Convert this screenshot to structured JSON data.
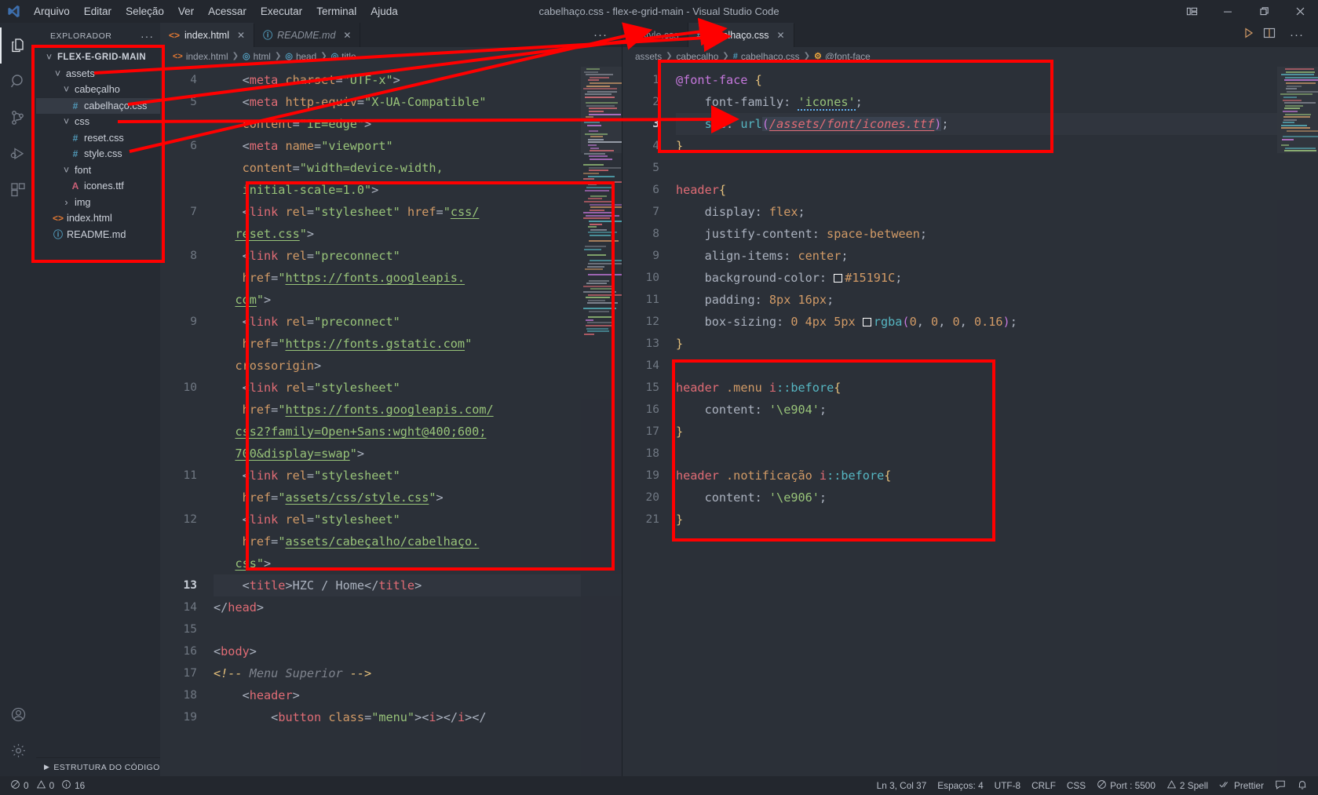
{
  "window": {
    "title": "cabelhaço.css - flex-e-grid-main - Visual Studio Code",
    "menu": [
      "Arquivo",
      "Editar",
      "Seleção",
      "Ver",
      "Acessar",
      "Executar",
      "Terminal",
      "Ajuda"
    ],
    "controls": {
      "layout": "layout-icon",
      "minimize": "—",
      "maximize": "❐",
      "close": "✕"
    }
  },
  "activitybar": {
    "items": [
      {
        "name": "explorer",
        "icon": "files-icon",
        "active": true
      },
      {
        "name": "search",
        "icon": "search-icon",
        "active": false
      },
      {
        "name": "source-control",
        "icon": "source-control-icon",
        "active": false
      },
      {
        "name": "run-and-debug",
        "icon": "run-debug-icon",
        "active": false
      },
      {
        "name": "extensions",
        "icon": "extensions-icon",
        "active": false
      }
    ],
    "bottom": [
      {
        "name": "accounts",
        "icon": "account-icon"
      },
      {
        "name": "settings",
        "icon": "gear-icon"
      }
    ]
  },
  "sidebar": {
    "header": "EXPLORADOR",
    "more": "···",
    "root": "FLEX-E-GRID-MAIN",
    "tree": [
      {
        "label": "FLEX-E-GRID-MAIN",
        "depth": 0,
        "kind": "root",
        "expanded": true
      },
      {
        "label": "assets",
        "depth": 1,
        "kind": "folder",
        "expanded": true
      },
      {
        "label": "cabeçalho",
        "depth": 2,
        "kind": "folder",
        "expanded": true
      },
      {
        "label": "cabelhaço.css",
        "depth": 3,
        "kind": "css",
        "selected": true
      },
      {
        "label": "css",
        "depth": 2,
        "kind": "folder",
        "expanded": true
      },
      {
        "label": "reset.css",
        "depth": 3,
        "kind": "css"
      },
      {
        "label": "style.css",
        "depth": 3,
        "kind": "css"
      },
      {
        "label": "font",
        "depth": 2,
        "kind": "folder",
        "expanded": true
      },
      {
        "label": "icones.ttf",
        "depth": 3,
        "kind": "ttf"
      },
      {
        "label": "img",
        "depth": 2,
        "kind": "folder",
        "expanded": false
      },
      {
        "label": "index.html",
        "depth": 1,
        "kind": "html"
      },
      {
        "label": "README.md",
        "depth": 1,
        "kind": "md"
      }
    ],
    "footer": "ESTRUTURA DO CÓDIGO"
  },
  "left_editor": {
    "tabs": [
      {
        "label": "index.html",
        "kind": "html",
        "active": true,
        "italic": false,
        "close": "✕"
      },
      {
        "label": "README.md",
        "kind": "md",
        "active": false,
        "italic": true,
        "close": "✕"
      }
    ],
    "more": "···",
    "breadcrumb": [
      {
        "label": "index.html",
        "icon": "html-icon"
      },
      {
        "label": "html",
        "icon": "tag-icon"
      },
      {
        "label": "head",
        "icon": "tag-icon"
      },
      {
        "label": "title",
        "icon": "tag-icon"
      }
    ],
    "first_line_number": 4,
    "lines": [
      {
        "n": "4",
        "html": "    <span class='t-punc'>&lt;</span><span class='t-tag'>meta</span> <span class='t-attr'>charset</span><span class='t-punc'>=</span><span class='t-str'>\"UTF-x\"</span><span class='t-punc'>&gt;</span>"
      },
      {
        "n": "5",
        "html": "    <span class='t-punc'>&lt;</span><span class='t-tag'>meta</span> <span class='t-attr'>http-equiv</span><span class='t-punc'>=</span><span class='t-str'>\"X-UA-Compatible\"</span>"
      },
      {
        "n": "",
        "html": "    <span class='t-attr'>content</span><span class='t-punc'>=</span><span class='t-str'>\"IE=edge\"</span><span class='t-punc'>&gt;</span>"
      },
      {
        "n": "6",
        "html": "    <span class='t-punc'>&lt;</span><span class='t-tag'>meta</span> <span class='t-attr'>name</span><span class='t-punc'>=</span><span class='t-str'>\"viewport\"</span>"
      },
      {
        "n": "",
        "html": "    <span class='t-attr'>content</span><span class='t-punc'>=</span><span class='t-str'>\"width=device-width,</span>"
      },
      {
        "n": "",
        "html": "    <span class='t-str'>initial-scale=1.0\"</span><span class='t-punc'>&gt;</span>"
      },
      {
        "n": "7",
        "html": "    <span class='t-punc'>&lt;</span><span class='t-tag'>link</span> <span class='t-attr'>rel</span><span class='t-punc'>=</span><span class='t-str'>\"stylesheet\"</span> <span class='t-attr'>href</span><span class='t-punc'>=</span><span class='t-str'>\"</span><span class='t-strlnk'>css/</span>"
      },
      {
        "n": "",
        "html": "   <span class='t-strlnk'>reset.css</span><span class='t-str'>\"</span><span class='t-punc'>&gt;</span>"
      },
      {
        "n": "8",
        "html": "    <span class='t-punc'>&lt;</span><span class='t-tag'>link</span> <span class='t-attr'>rel</span><span class='t-punc'>=</span><span class='t-str'>\"preconnect\"</span>"
      },
      {
        "n": "",
        "html": "    <span class='t-attr'>href</span><span class='t-punc'>=</span><span class='t-str'>\"</span><span class='t-strlnk'>https://fonts.googleapis.</span>"
      },
      {
        "n": "",
        "html": "   <span class='t-strlnk'>com</span><span class='t-str'>\"</span><span class='t-punc'>&gt;</span>"
      },
      {
        "n": "9",
        "html": "    <span class='t-punc'>&lt;</span><span class='t-tag'>link</span> <span class='t-attr'>rel</span><span class='t-punc'>=</span><span class='t-str'>\"preconnect\"</span>"
      },
      {
        "n": "",
        "html": "    <span class='t-attr'>href</span><span class='t-punc'>=</span><span class='t-str'>\"</span><span class='t-strlnk'>https://fonts.gstatic.com</span><span class='t-str'>\"</span>"
      },
      {
        "n": "",
        "html": "   <span class='t-attr'>crossorigin</span><span class='t-punc'>&gt;</span>"
      },
      {
        "n": "10",
        "html": "    <span class='t-punc'>&lt;</span><span class='t-tag'>link</span> <span class='t-attr'>rel</span><span class='t-punc'>=</span><span class='t-str'>\"stylesheet\"</span>"
      },
      {
        "n": "",
        "html": "    <span class='t-attr'>href</span><span class='t-punc'>=</span><span class='t-str'>\"</span><span class='t-strlnk'>https://fonts.googleapis.com/</span>"
      },
      {
        "n": "",
        "html": "   <span class='t-strlnk'>css2?family=Open+Sans:wght@400;600;</span>"
      },
      {
        "n": "",
        "html": "   <span class='t-strlnk'>700&amp;display=swap</span><span class='t-str'>\"</span><span class='t-punc'>&gt;</span>"
      },
      {
        "n": "11",
        "html": "    <span class='t-punc'>&lt;</span><span class='t-tag'>link</span> <span class='t-attr'>rel</span><span class='t-punc'>=</span><span class='t-str'>\"stylesheet\"</span>"
      },
      {
        "n": "",
        "html": "    <span class='t-attr'>href</span><span class='t-punc'>=</span><span class='t-str'>\"</span><span class='t-strlnk'>assets/css/style.css</span><span class='t-str'>\"</span><span class='t-punc'>&gt;</span>"
      },
      {
        "n": "12",
        "html": "    <span class='t-punc'>&lt;</span><span class='t-tag'>link</span> <span class='t-attr'>rel</span><span class='t-punc'>=</span><span class='t-str'>\"stylesheet\"</span>"
      },
      {
        "n": "",
        "html": "    <span class='t-attr'>href</span><span class='t-punc'>=</span><span class='t-str'>\"</span><span class='t-strlnk'>assets/cabeçalho/cabelhaço.</span>"
      },
      {
        "n": "",
        "html": "   <span class='t-strlnk'>css</span><span class='t-str'>\"</span><span class='t-punc'>&gt;</span>"
      },
      {
        "n": "13",
        "html": "    <span class='t-punc'>&lt;</span><span class='t-tag'>title</span><span class='t-punc'>&gt;</span>HZC / Home<span class='t-punc'>&lt;/</span><span class='t-tag'>title</span><span class='t-punc'>&gt;</span>",
        "cur": true,
        "hl": true
      },
      {
        "n": "14",
        "html": "<span class='t-punc'>&lt;/</span><span class='t-tag'>head</span><span class='t-punc'>&gt;</span>"
      },
      {
        "n": "15",
        "html": ""
      },
      {
        "n": "16",
        "html": "<span class='t-punc'>&lt;</span><span class='t-tag'>body</span><span class='t-punc'>&gt;</span>"
      },
      {
        "n": "17",
        "html": "<span class='t-cmtm'>&lt;!--</span> <span class='t-cmt'>Menu Superior</span> <span class='t-cmtm'>--&gt;</span>"
      },
      {
        "n": "18",
        "html": "    <span class='t-punc'>&lt;</span><span class='t-tag'>header</span><span class='t-punc'>&gt;</span>"
      },
      {
        "n": "19",
        "html": "        <span class='t-punc'>&lt;</span><span class='t-tag'>button</span> <span class='t-attr'>class</span><span class='t-punc'>=</span><span class='t-str'>\"menu\"</span><span class='t-punc'>&gt;&lt;</span><span class='t-tag'>i</span><span class='t-punc'>&gt;&lt;/</span><span class='t-tag'>i</span><span class='t-punc'>&gt;&lt;/</span>"
      }
    ]
  },
  "right_editor": {
    "tabs": [
      {
        "label": "style.css",
        "kind": "css",
        "active": false,
        "close": ""
      },
      {
        "label": "cabelhaço.css",
        "kind": "css",
        "active": true,
        "close": "✕"
      }
    ],
    "actions": {
      "run": "run-icon",
      "split": "split-editor-icon",
      "more": "···"
    },
    "breadcrumb": [
      {
        "label": "assets",
        "icon": ""
      },
      {
        "label": "cabeçalho",
        "icon": ""
      },
      {
        "label": "cabelhaço.css",
        "icon": "css-icon"
      },
      {
        "label": "@font-face",
        "icon": "at-rule-icon"
      }
    ],
    "lines": [
      {
        "n": "1",
        "html": "<span class='t-at'>@font-face</span> <span class='t-brace'>{</span>"
      },
      {
        "n": "2",
        "html": "    <span class='t-prop'>font-family</span><span class='t-punc'>:</span> <span class='t-squig t-qstr'>'icones'</span><span class='t-punc'>;</span>"
      },
      {
        "n": "3",
        "html": "    <span class='t-fn'>src</span><span class='t-punc'>:</span> <span class='t-fn'>url</span><span class='t-urlsel'><span class='t-paren'>(</span><span class='t-url'>/assets/font/icones.ttf</span><span class='t-paren'>)</span></span><span class='t-punc'>;</span>",
        "cur": true,
        "hl": true
      },
      {
        "n": "4",
        "html": "<span class='t-brace'>}</span>"
      },
      {
        "n": "5",
        "html": ""
      },
      {
        "n": "6",
        "html": "<span class='t-sel'>header</span><span class='t-brace'>{</span>"
      },
      {
        "n": "7",
        "html": "    <span class='t-prop'>display</span><span class='t-punc'>:</span> <span class='t-val'>flex</span><span class='t-punc'>;</span>"
      },
      {
        "n": "8",
        "html": "    <span class='t-prop'>justify-content</span><span class='t-punc'>:</span> <span class='t-val'>space-between</span><span class='t-punc'>;</span>"
      },
      {
        "n": "9",
        "html": "    <span class='t-prop'>align-items</span><span class='t-punc'>:</span> <span class='t-val'>center</span><span class='t-punc'>;</span>"
      },
      {
        "n": "10",
        "html": "    <span class='t-prop'>background-color</span><span class='t-punc'>:</span> <span class='swatch'></span><span class='t-hex'>#15191C</span><span class='t-punc'>;</span>"
      },
      {
        "n": "11",
        "html": "    <span class='t-prop'>padding</span><span class='t-punc'>:</span> <span class='t-num'>8px</span> <span class='t-num'>16px</span><span class='t-punc'>;</span>"
      },
      {
        "n": "12",
        "html": "    <span class='t-prop'>box-sizing</span><span class='t-punc'>:</span> <span class='t-num'>0</span> <span class='t-num'>4px</span> <span class='t-num'>5px</span> <span class='swatch'></span><span class='t-fn'>rgba</span><span class='t-paren'>(</span><span class='t-num'>0</span><span class='t-punc'>,</span> <span class='t-num'>0</span><span class='t-punc'>,</span> <span class='t-num'>0</span><span class='t-punc'>,</span> <span class='t-num'>0.16</span><span class='t-paren'>)</span><span class='t-punc'>;</span>"
      },
      {
        "n": "13",
        "html": "<span class='t-brace'>}</span>"
      },
      {
        "n": "14",
        "html": ""
      },
      {
        "n": "15",
        "html": "<span class='t-sel'>header</span> <span class='t-cls'>.menu</span> <span class='t-sel'>i</span><span class='t-pseudo'>::before</span><span class='t-brace'>{</span>"
      },
      {
        "n": "16",
        "html": "    <span class='t-prop'>content</span><span class='t-punc'>:</span> <span class='t-qstr'>'\\e904'</span><span class='t-punc'>;</span>"
      },
      {
        "n": "17",
        "html": "<span class='t-brace'>}</span>"
      },
      {
        "n": "18",
        "html": ""
      },
      {
        "n": "19",
        "html": "<span class='t-sel'>header</span> <span class='t-cls'>.notificação</span> <span class='t-sel'>i</span><span class='t-pseudo'>::before</span><span class='t-brace'>{</span>"
      },
      {
        "n": "20",
        "html": "    <span class='t-prop'>content</span><span class='t-punc'>:</span> <span class='t-qstr'>'\\e906'</span><span class='t-punc'>;</span>"
      },
      {
        "n": "21",
        "html": "<span class='t-brace'>}</span>"
      }
    ]
  },
  "statusbar": {
    "left": [
      {
        "name": "problems",
        "icon": "error-icon",
        "text": "0"
      },
      {
        "name": "warnings",
        "icon": "warning-icon",
        "text": "0"
      },
      {
        "name": "infos",
        "icon": "info-icon",
        "text": "16"
      }
    ],
    "right": [
      {
        "name": "cursor-position",
        "text": "Ln 3, Col 37"
      },
      {
        "name": "indentation",
        "text": "Espaços: 4"
      },
      {
        "name": "encoding",
        "text": "UTF-8"
      },
      {
        "name": "eol",
        "text": "CRLF"
      },
      {
        "name": "language-mode",
        "text": "CSS"
      },
      {
        "name": "live-server-port",
        "text": "Port : 5500",
        "icon": "broadcast-icon"
      },
      {
        "name": "spell-checker",
        "text": "2 Spell",
        "icon": "warning-icon"
      },
      {
        "name": "prettier",
        "text": "Prettier",
        "icon": "check-icon"
      },
      {
        "name": "feedback",
        "text": "",
        "icon": "feedback-icon"
      },
      {
        "name": "notifications",
        "text": "",
        "icon": "bell-icon"
      }
    ]
  },
  "annotations": {
    "color": "#FF0000",
    "boxes": [
      {
        "name": "sidebar-file-tree-box"
      },
      {
        "name": "index-html-links-box"
      },
      {
        "name": "font-face-rule-box"
      },
      {
        "name": "icon-pseudo-rules-box"
      }
    ],
    "arrows": [
      {
        "name": "assets-to-cabelhaco-tab-arrow"
      },
      {
        "name": "cabelhaco-css-to-src-url-arrow"
      },
      {
        "name": "style-css-to-style-tab-arrow"
      }
    ]
  }
}
